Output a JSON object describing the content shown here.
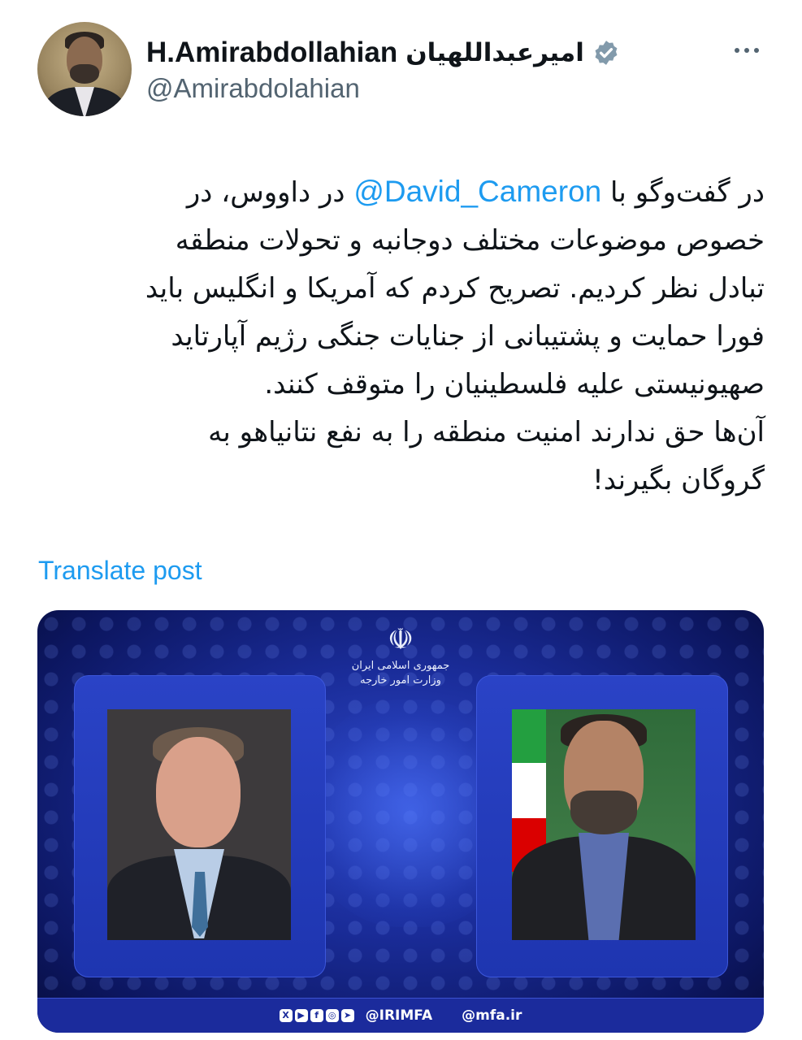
{
  "author": {
    "name_latin": "H.Amirabdollahian",
    "name_fa": "امیرعبداللهیان",
    "handle": "@Amirabdolahian",
    "verified_icon": "verified-badge-icon",
    "more_icon": "more-dots-icon"
  },
  "post": {
    "line1_before": "در گفت‌وگو با ",
    "mention": "@David_Cameron",
    "line1_after": " در داووس، در",
    "line2": "خصوص موضوعات مختلف دوجانبه و تحولات منطقه",
    "line3": "تبادل نظر کردیم. تصریح کردم که آمریکا و انگلیس باید",
    "line4": "فورا حمایت و پشتیبانی از جنایات جنگی رژیم آپارتاید",
    "line5": "صهیونیستی علیه فلسطینیان را متوقف کنند.",
    "line6": "آن‌ها حق ندارند امنیت منطقه را به نفع نتانیاهو به",
    "line7": "گروگان بگیرند!"
  },
  "translate_label": "Translate post",
  "media": {
    "emblem_line1": "جمهوری اسلامی ایران",
    "emblem_line2": "وزارت امور خارجه",
    "footer_handle": "@IRIMFA",
    "footer_site": "@mfa.ir",
    "colors": {
      "background": "#1a2c99",
      "footer": "#1b2b9c"
    }
  },
  "colors": {
    "link": "#1d9bf0",
    "text": "#0f1419",
    "muted": "#536471"
  }
}
